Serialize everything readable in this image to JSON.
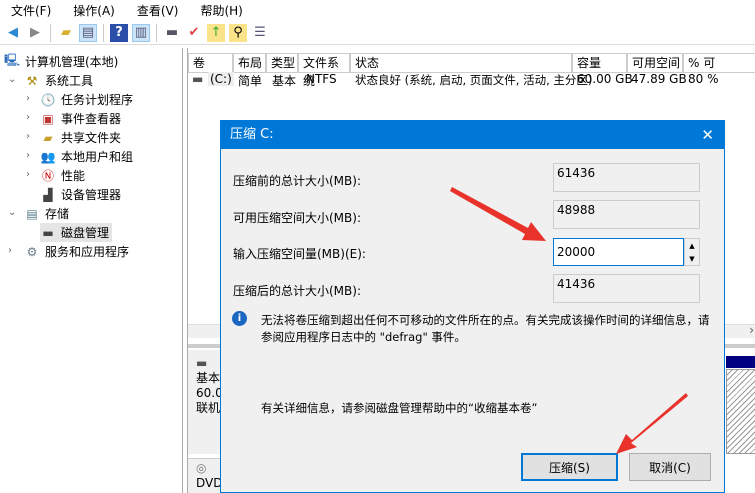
{
  "menu": [
    "文件(F)",
    "操作(A)",
    "查看(V)",
    "帮助(H)"
  ],
  "tree": {
    "root": "计算机管理(本地)",
    "system_tools": "系统工具",
    "task_scheduler": "任务计划程序",
    "event_viewer": "事件查看器",
    "shared_folders": "共享文件夹",
    "local_users": "本地用户和组",
    "performance": "性能",
    "device_manager": "设备管理器",
    "storage": "存储",
    "disk_management": "磁盘管理",
    "services": "服务和应用程序"
  },
  "volumes": {
    "columns": [
      "卷",
      "布局",
      "类型",
      "文件系统",
      "状态",
      "容量",
      "可用空间",
      "% 可"
    ],
    "rows": [
      {
        "volume": "(C:)",
        "layout": "简单",
        "type": "基本",
        "fs": "NTFS",
        "status": "状态良好 (系统, 启动, 页面文件, 活动, 主分区)",
        "capacity": "60.00 GB",
        "free": "47.89 GB",
        "pct": "80 %"
      }
    ]
  },
  "disk_pane": {
    "line1": "基本",
    "line2": "60.0",
    "line3": "联机",
    "dvd": "DVD"
  },
  "dialog": {
    "title": "压缩 C:",
    "total_before_label": "压缩前的总计大小(MB):",
    "total_before": "61436",
    "available_label": "可用压缩空间大小(MB):",
    "available": "48988",
    "amount_label": "输入压缩空间量(MB)(E):",
    "amount": "20000",
    "total_after_label": "压缩后的总计大小(MB):",
    "total_after": "41436",
    "info": "无法将卷压缩到超出任何不可移动的文件所在的点。有关完成该操作时间的详细信息，请参阅应用程序日志中的 \"defrag\" 事件。",
    "help": "有关详细信息，请参阅磁盘管理帮助中的“收缩基本卷”",
    "shrink_button": "压缩(S)",
    "cancel_button": "取消(C)"
  },
  "colors": {
    "accent": "#0078d7",
    "arrow": "#e8322a"
  }
}
